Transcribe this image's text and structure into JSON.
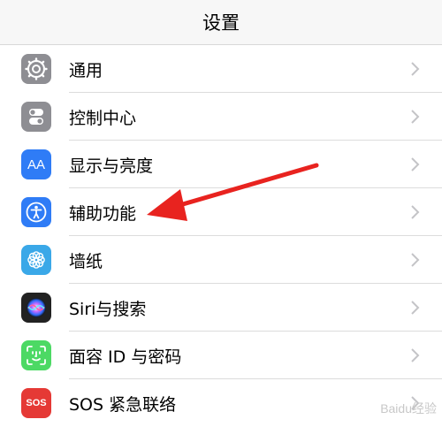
{
  "header": {
    "title": "设置"
  },
  "settings": [
    {
      "label": "通用",
      "icon": "gear-icon",
      "color": "#8e8e93"
    },
    {
      "label": "控制中心",
      "icon": "toggle-icon",
      "color": "#8e8e93"
    },
    {
      "label": "显示与亮度",
      "icon": "text-size-icon",
      "color": "#2f7cf6"
    },
    {
      "label": "辅助功能",
      "icon": "accessibility-icon",
      "color": "#2f7cf6"
    },
    {
      "label": "墙纸",
      "icon": "flower-icon",
      "color": "#3aa8e8"
    },
    {
      "label": "Siri与搜索",
      "icon": "siri-icon",
      "color": "#222"
    },
    {
      "label": "面容 ID 与密码",
      "icon": "face-id-icon",
      "color": "#4cd964"
    },
    {
      "label": "SOS 紧急联络",
      "icon": "sos-icon",
      "color": "#e53935"
    }
  ],
  "icon_text": {
    "aa": "AA",
    "sos": "SOS"
  },
  "annotation": {
    "arrow_color": "#e8231f"
  },
  "watermark": "Baidu经验"
}
